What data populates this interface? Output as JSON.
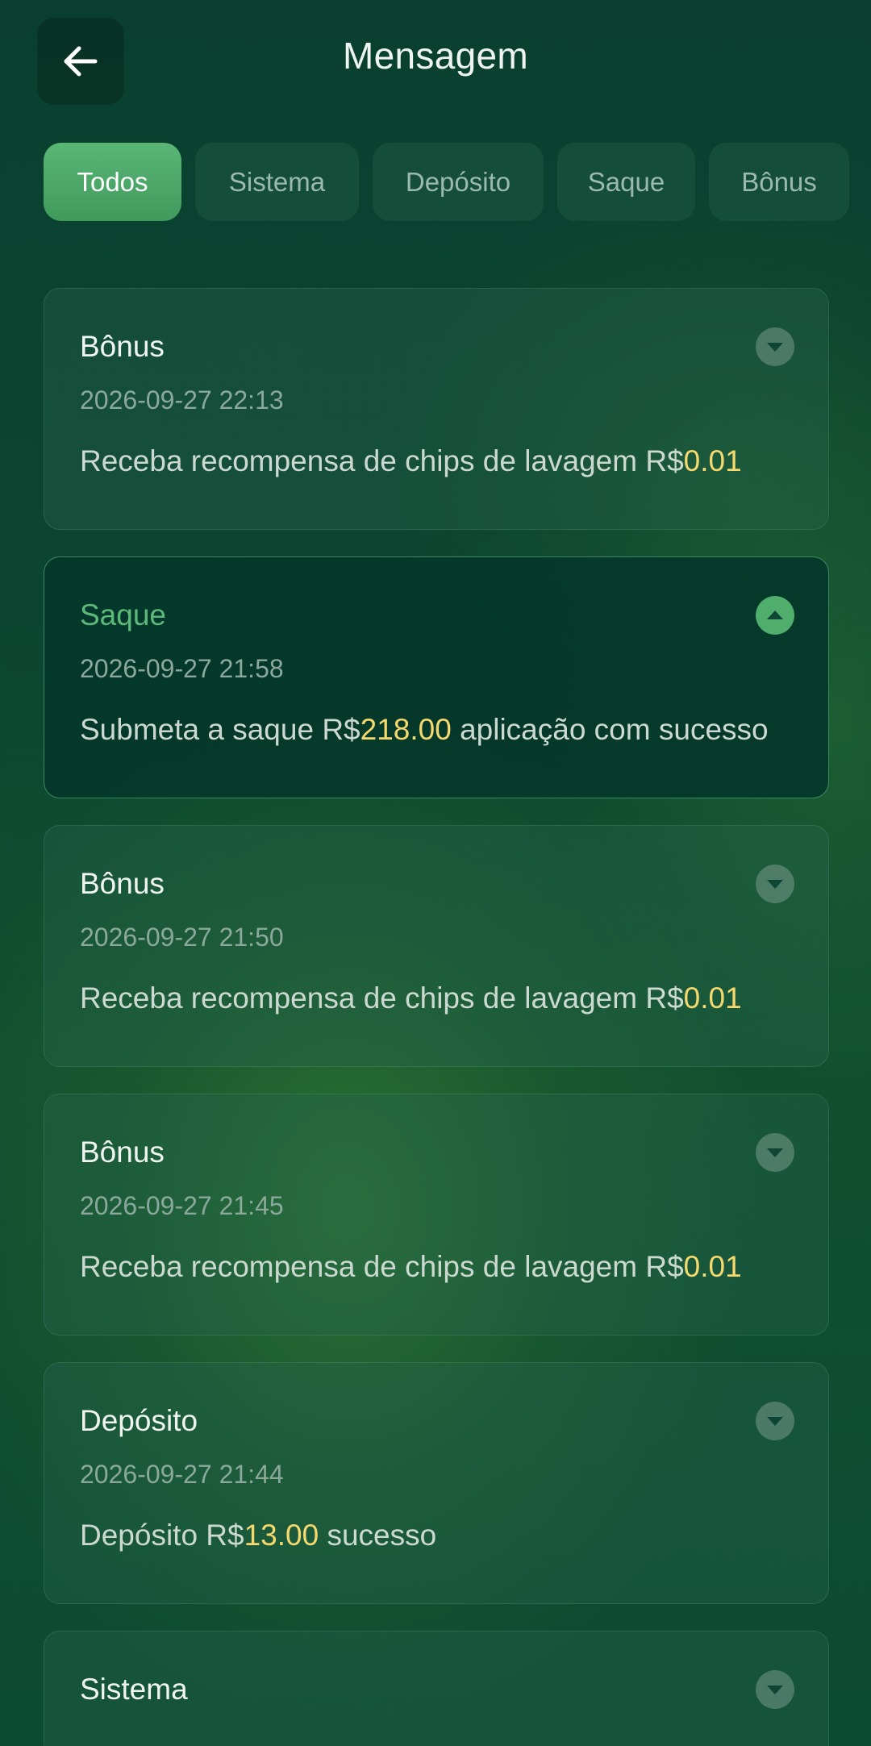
{
  "header": {
    "title": "Mensagem",
    "back_icon": "arrow-left-icon"
  },
  "tabs": [
    {
      "label": "Todos",
      "active": true
    },
    {
      "label": "Sistema",
      "active": false
    },
    {
      "label": "Depósito",
      "active": false
    },
    {
      "label": "Saque",
      "active": false
    },
    {
      "label": "Bônus",
      "active": false
    }
  ],
  "colors": {
    "accent": "#4fae6c",
    "amount": "#f5d96e",
    "background": "#0b4531"
  },
  "messages": [
    {
      "title": "Bônus",
      "time": "2026-09-27 22:13",
      "text_before": "Receba recompensa de chips de lavagem R$",
      "amount": "0.01",
      "text_after": "",
      "expanded": false
    },
    {
      "title": "Saque",
      "time": "2026-09-27 21:58",
      "text_before": "Submeta a saque R$",
      "amount": "218.00",
      "text_after": " aplicação com sucesso",
      "expanded": true
    },
    {
      "title": "Bônus",
      "time": "2026-09-27 21:50",
      "text_before": "Receba recompensa de chips de lavagem R$",
      "amount": "0.01",
      "text_after": "",
      "expanded": false
    },
    {
      "title": "Bônus",
      "time": "2026-09-27 21:45",
      "text_before": "Receba recompensa de chips de lavagem R$",
      "amount": "0.01",
      "text_after": "",
      "expanded": false
    },
    {
      "title": "Depósito",
      "time": "2026-09-27 21:44",
      "text_before": "Depósito R$",
      "amount": "13.00",
      "text_after": " sucesso",
      "expanded": false
    },
    {
      "title": "Sistema",
      "expanded": false
    }
  ]
}
